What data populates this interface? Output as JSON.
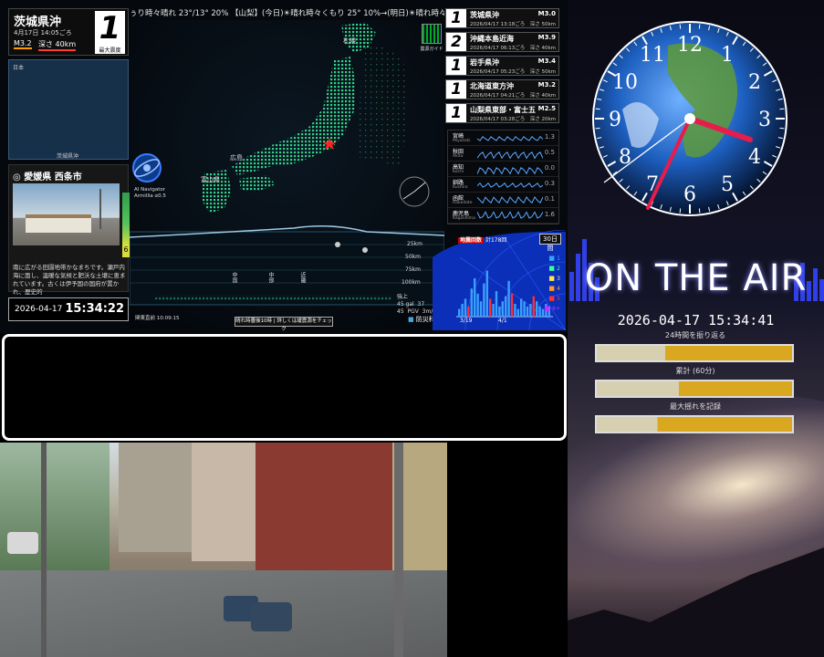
{
  "ticker": "ぅり時々晴れ 23°/13° 20% 【山梨】(今日)☀晴れ時々くもり 25° 10%→(明日)☀晴れ時々くもり 25°/10° 】",
  "main_quake": {
    "place": "茨城県沖",
    "time": "4月17日 14:05ごろ",
    "magnitude": "M3.2",
    "depth": "深さ 40km",
    "intensity": "1",
    "intensity_label": "最大震度"
  },
  "minimap": {
    "label_top": "日本",
    "label_bottom": "茨城県沖"
  },
  "location": {
    "name": "愛媛県 西条市",
    "intensity_badge": "6",
    "description": "南に広がる田園地帯かなまちです。瀬戸内海に面し、温暖な気候と肥沃な土壌に恵まれています。古くは伊予国の国府が置かれ、歴史的"
  },
  "local_clock": {
    "date": "2026-04-17",
    "time": "15:34:22"
  },
  "map_labels": {
    "ai_nav": "AI Navigator\nArmillla α0.5",
    "hiroshima": "広島",
    "toyama": "富山県",
    "guide": "震源ガイド",
    "depth_25": "25km",
    "depth_50": "50km",
    "depth_75": "75km",
    "depth_100": "100km",
    "chugoku": "中国",
    "gokyu": "中部",
    "kinki": "近畿",
    "banner": "晴れ時曇後10時 | 詳しくは緩震源をチェック",
    "strength": "強上\n45 gal  37\n45  PGV  3m/s",
    "bosai": "防災科研",
    "bottom_left": "関東直前 10:09:15"
  },
  "quake_list": [
    {
      "intensity": "1",
      "place": "茨城県沖",
      "time": "2026/04/17 13:18ごろ",
      "mag": "M3.0",
      "depth": "深さ 50km"
    },
    {
      "intensity": "2",
      "place": "沖縄本島近海",
      "time": "2026/04/17 06:13ごろ",
      "mag": "M3.9",
      "depth": "深さ 40km"
    },
    {
      "intensity": "1",
      "place": "岩手県沖",
      "time": "2026/04/17 05:23ごろ",
      "mag": "M3.4",
      "depth": "深さ 50km"
    },
    {
      "intensity": "1",
      "place": "北海道東方沖",
      "time": "2026/04/17 04:21ごろ",
      "mag": "M3.2",
      "depth": "深さ 40km"
    },
    {
      "intensity": "1",
      "place": "山梨県東部・富士五",
      "time": "2026/04/17 03:28ごろ",
      "mag": "M2.5",
      "depth": "深さ 20km"
    }
  ],
  "sensors": [
    {
      "name": "宮崎",
      "romaji": "Miyazaki",
      "value": "1.3"
    },
    {
      "name": "秋田",
      "romaji": "Akita",
      "value": "0.5"
    },
    {
      "name": "高知",
      "romaji": "Kochi",
      "value": "0.0"
    },
    {
      "name": "釧路",
      "romaji": "Kushiro",
      "value": "0.3"
    },
    {
      "name": "函館",
      "romaji": "Hakodate",
      "value": "0.1"
    },
    {
      "name": "鹿児島",
      "romaji": "Kagoshima",
      "value": "1.6"
    }
  ],
  "histogram": {
    "title": "地震回数",
    "subtitle": "計178回",
    "button": "30日間",
    "legend": [
      "1",
      "2",
      "3",
      "4",
      "5",
      "6+"
    ],
    "legend_colors": [
      "#3aa0ff",
      "#3aff9a",
      "#ffe84a",
      "#ff9a2a",
      "#ff3030",
      "#c030ff"
    ],
    "axis_left": "3/19",
    "axis_mid": "4/1"
  },
  "right_panel": {
    "clock_numbers": [
      "12",
      "1",
      "2",
      "3",
      "4",
      "5",
      "6",
      "7",
      "8",
      "9",
      "10",
      "11"
    ],
    "on_air": "ON THE AIR",
    "datetime": "2026-04-17 15:34:41",
    "stats": [
      {
        "label": "24時間を振り返る",
        "level": 0.35
      },
      {
        "label": "累計 (60分)",
        "level": 0.42
      },
      {
        "label": "最大揺れを記録",
        "level": 0.31
      }
    ]
  }
}
